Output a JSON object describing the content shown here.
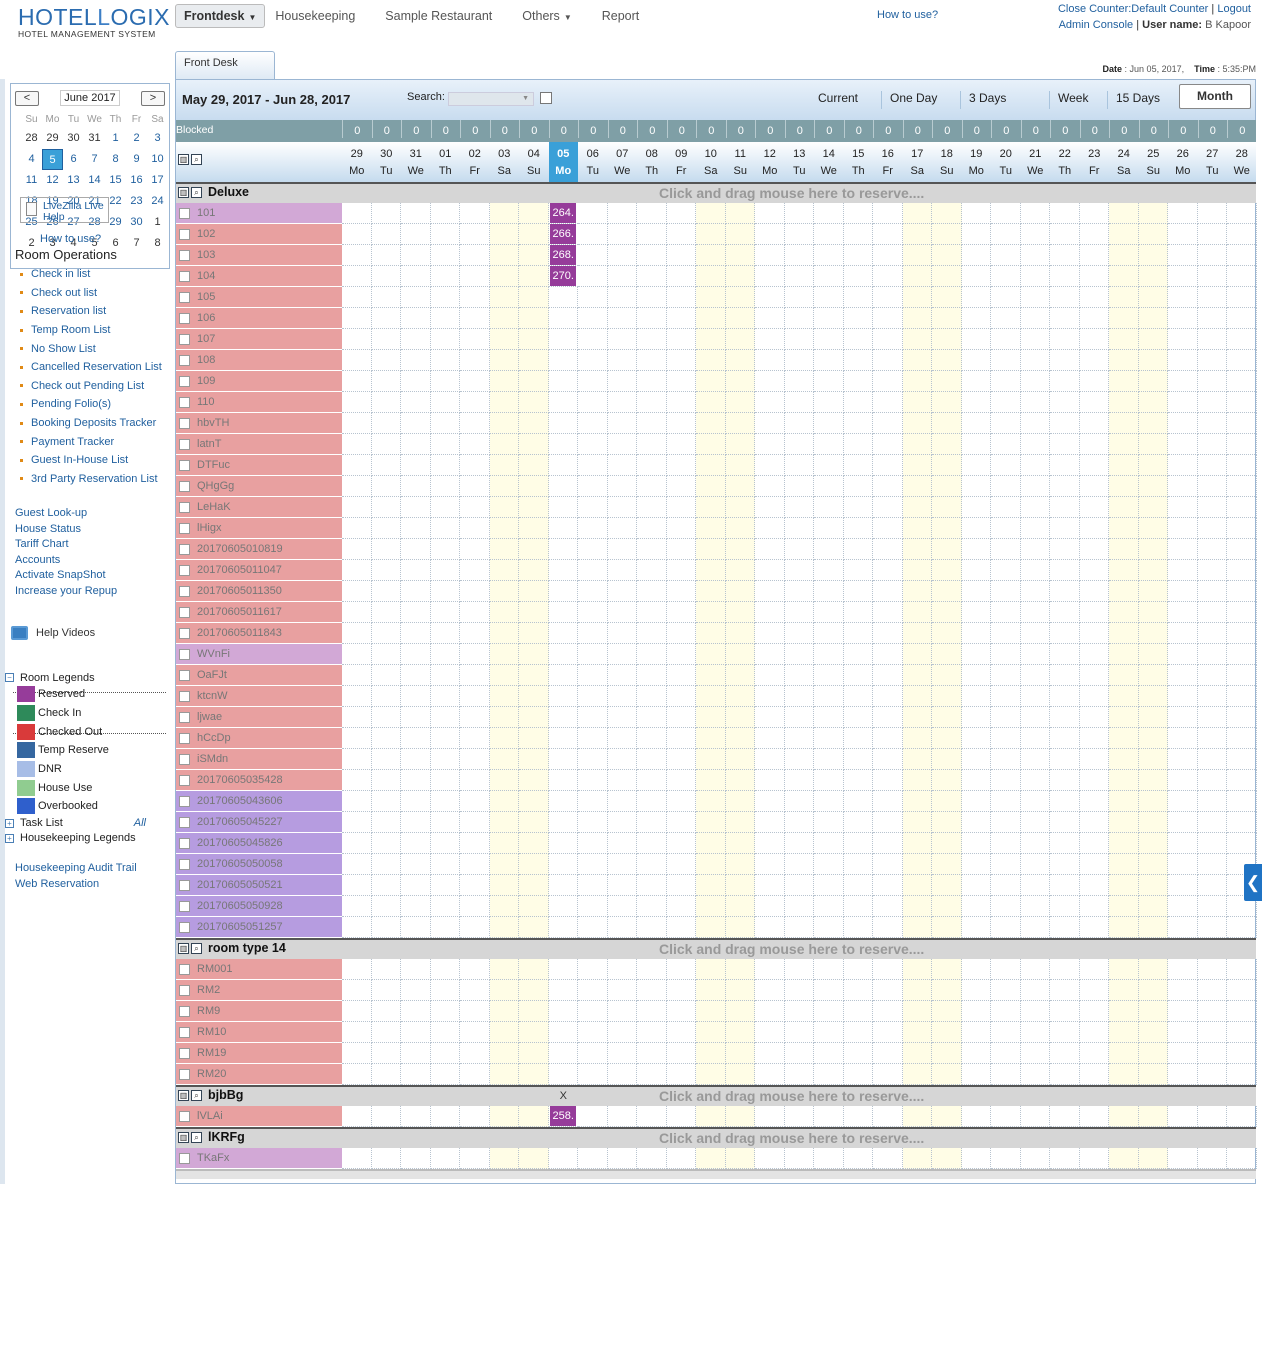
{
  "brand": {
    "name_a": "HOTEL",
    "name_b": "OGIX",
    "name_l": "L",
    "tagline": "HOTEL MANAGEMENT SYSTEM"
  },
  "nav": {
    "items": [
      {
        "label": "Frontdesk",
        "active": true,
        "dropdown": true
      },
      {
        "label": "Housekeeping"
      },
      {
        "label": "Sample Restaurant"
      },
      {
        "label": "Others",
        "dropdown": true
      },
      {
        "label": "Report"
      }
    ],
    "how_to_use": "How to use?"
  },
  "topright": {
    "close_counter": "Close Counter:Default Counter",
    "logout": "Logout",
    "admin_console": "Admin Console",
    "user_label": "User name:",
    "user_name": "B Kapoor"
  },
  "tab": "Front Desk",
  "datetime": {
    "date_label": "Date",
    "date": "Jun 05, 2017,",
    "time_label": "Time",
    "time": "5:35:PM"
  },
  "calendar": {
    "title": "June 2017",
    "prev": "<",
    "next": ">",
    "dow": [
      "Su",
      "Mo",
      "Tu",
      "We",
      "Th",
      "Fr",
      "Sa"
    ],
    "weeks": [
      [
        28,
        29,
        30,
        31,
        1,
        2,
        3
      ],
      [
        4,
        5,
        6,
        7,
        8,
        9,
        10
      ],
      [
        11,
        12,
        13,
        14,
        15,
        16,
        17
      ],
      [
        18,
        19,
        20,
        21,
        22,
        23,
        24
      ],
      [
        25,
        26,
        27,
        28,
        29,
        30,
        1
      ],
      [
        2,
        3,
        4,
        5,
        6,
        7,
        8
      ]
    ],
    "selected": 5
  },
  "livezilla": "LiveZilla Live Help",
  "side_how": "How to use?",
  "room_operations": {
    "title": "Room Operations",
    "items": [
      "Check in list",
      "Check out list",
      "Reservation list",
      "Temp Room List",
      "No Show List",
      "Cancelled Reservation List",
      "Check out Pending List",
      "Pending Folio(s)",
      "Booking Deposits Tracker",
      "Payment Tracker",
      "Guest In-House List",
      "3rd Party Reservation List"
    ]
  },
  "links2": [
    "Guest Look-up",
    "House Status",
    "Tariff Chart",
    "Accounts",
    "Activate SnapShot",
    "Increase your Repup"
  ],
  "help_videos": "Help Videos",
  "room_legends": {
    "title": "Room Legends",
    "items": [
      {
        "label": "Reserved",
        "color": "#963c9a"
      },
      {
        "label": "Check In",
        "color": "#2e8a5a"
      },
      {
        "label": "Checked Out",
        "color": "#d93a3a"
      },
      {
        "label": "Temp Reserve",
        "color": "#3567a0"
      },
      {
        "label": "DNR",
        "color": "#a7bde6"
      },
      {
        "label": "House Use",
        "color": "#90cc90"
      },
      {
        "label": "Overbooked",
        "color": "#2f5fcc"
      }
    ]
  },
  "task_list": "Task List",
  "task_all": "All",
  "housekeeping_legends": "Housekeeping Legends",
  "links3": [
    "Housekeeping Audit Trail",
    "Web Reservation"
  ],
  "toolbar": {
    "range": "May 29, 2017 - Jun 28, 2017",
    "search_label": "Search:",
    "views": [
      "Current",
      "One Day",
      "3 Days",
      "Week",
      "15 Days",
      "Month"
    ],
    "active_view": "Month"
  },
  "grid": {
    "blocked_label": "Blocked",
    "days": [
      {
        "d": "29",
        "w": "Mo"
      },
      {
        "d": "30",
        "w": "Tu"
      },
      {
        "d": "31",
        "w": "We"
      },
      {
        "d": "01",
        "w": "Th"
      },
      {
        "d": "02",
        "w": "Fr"
      },
      {
        "d": "03",
        "w": "Sa"
      },
      {
        "d": "04",
        "w": "Su"
      },
      {
        "d": "05",
        "w": "Mo"
      },
      {
        "d": "06",
        "w": "Tu"
      },
      {
        "d": "07",
        "w": "We"
      },
      {
        "d": "08",
        "w": "Th"
      },
      {
        "d": "09",
        "w": "Fr"
      },
      {
        "d": "10",
        "w": "Sa"
      },
      {
        "d": "11",
        "w": "Su"
      },
      {
        "d": "12",
        "w": "Mo"
      },
      {
        "d": "13",
        "w": "Tu"
      },
      {
        "d": "14",
        "w": "We"
      },
      {
        "d": "15",
        "w": "Th"
      },
      {
        "d": "16",
        "w": "Fr"
      },
      {
        "d": "17",
        "w": "Sa"
      },
      {
        "d": "18",
        "w": "Su"
      },
      {
        "d": "19",
        "w": "Mo"
      },
      {
        "d": "20",
        "w": "Tu"
      },
      {
        "d": "21",
        "w": "We"
      },
      {
        "d": "22",
        "w": "Th"
      },
      {
        "d": "23",
        "w": "Fr"
      },
      {
        "d": "24",
        "w": "Sa"
      },
      {
        "d": "25",
        "w": "Su"
      },
      {
        "d": "26",
        "w": "Mo"
      },
      {
        "d": "27",
        "w": "Tu"
      },
      {
        "d": "28",
        "w": "We"
      }
    ],
    "blocked": [
      "0",
      "0",
      "0",
      "0",
      "0",
      "0",
      "0",
      "0",
      "0",
      "0",
      "0",
      "0",
      "0",
      "0",
      "0",
      "0",
      "0",
      "0",
      "0",
      "0",
      "0",
      "0",
      "0",
      "0",
      "0",
      "0",
      "0",
      "0",
      "0",
      "0",
      "0"
    ],
    "today_index": 7,
    "weekend_indices": [
      5,
      6,
      12,
      13,
      19,
      20,
      26,
      27
    ],
    "drag_hint": "Click and drag mouse here to reserve....",
    "groups": [
      {
        "name": "Deluxe",
        "rooms": [
          {
            "name": "101",
            "status": "mauve",
            "res": "264."
          },
          {
            "name": "102",
            "status": "pink",
            "res": "266."
          },
          {
            "name": "103",
            "status": "pink",
            "res": "268."
          },
          {
            "name": "104",
            "status": "pink",
            "res": "270."
          },
          {
            "name": "105",
            "status": "pink"
          },
          {
            "name": "106",
            "status": "pink"
          },
          {
            "name": "107",
            "status": "pink"
          },
          {
            "name": "108",
            "status": "pink"
          },
          {
            "name": "109",
            "status": "pink"
          },
          {
            "name": "110",
            "status": "pink"
          },
          {
            "name": "hbvTH",
            "status": "pink"
          },
          {
            "name": "latnT",
            "status": "pink"
          },
          {
            "name": "DTFuc",
            "status": "pink"
          },
          {
            "name": "QHgGg",
            "status": "pink"
          },
          {
            "name": "LeHaK",
            "status": "pink"
          },
          {
            "name": "lHigx",
            "status": "pink"
          },
          {
            "name": "20170605010819",
            "status": "pink"
          },
          {
            "name": "20170605011047",
            "status": "pink"
          },
          {
            "name": "20170605011350",
            "status": "pink"
          },
          {
            "name": "20170605011617",
            "status": "pink"
          },
          {
            "name": "20170605011843",
            "status": "pink"
          },
          {
            "name": "WVnFi",
            "status": "mauve"
          },
          {
            "name": "OaFJt",
            "status": "pink"
          },
          {
            "name": "ktcnW",
            "status": "pink"
          },
          {
            "name": "ljwae",
            "status": "pink"
          },
          {
            "name": "hCcDp",
            "status": "pink"
          },
          {
            "name": "iSMdn",
            "status": "pink"
          },
          {
            "name": "20170605035428",
            "status": "pink"
          },
          {
            "name": "20170605043606",
            "status": "purple"
          },
          {
            "name": "20170605045227",
            "status": "purple"
          },
          {
            "name": "20170605045826",
            "status": "purple"
          },
          {
            "name": "20170605050058",
            "status": "purple"
          },
          {
            "name": "20170605050521",
            "status": "purple"
          },
          {
            "name": "20170605050928",
            "status": "purple"
          },
          {
            "name": "20170605051257",
            "status": "purple"
          }
        ]
      },
      {
        "name": "room type 14",
        "rooms": [
          {
            "name": "RM001",
            "status": "pink"
          },
          {
            "name": "RM2",
            "status": "pink"
          },
          {
            "name": "RM9",
            "status": "pink"
          },
          {
            "name": "RM10",
            "status": "pink"
          },
          {
            "name": "RM19",
            "status": "pink"
          },
          {
            "name": "RM20",
            "status": "pink"
          }
        ]
      },
      {
        "name": "bjbBg",
        "marker": "X",
        "rooms": [
          {
            "name": "lVLAi",
            "status": "pink",
            "res": "258."
          }
        ]
      },
      {
        "name": "lKRFg",
        "rooms": [
          {
            "name": "TKaFx",
            "status": "mauve"
          }
        ]
      }
    ]
  },
  "colors": {
    "pink": "#e8a0a0",
    "mauve": "#d2a8d6",
    "purple": "#b69ce0",
    "reserved": "#963c9a",
    "today": "#3aa0d8",
    "weekend": "#fffde6",
    "blocked_bar": "#7f9fa6",
    "group_bar": "#d6d6d6"
  },
  "side_toggle": "❮"
}
